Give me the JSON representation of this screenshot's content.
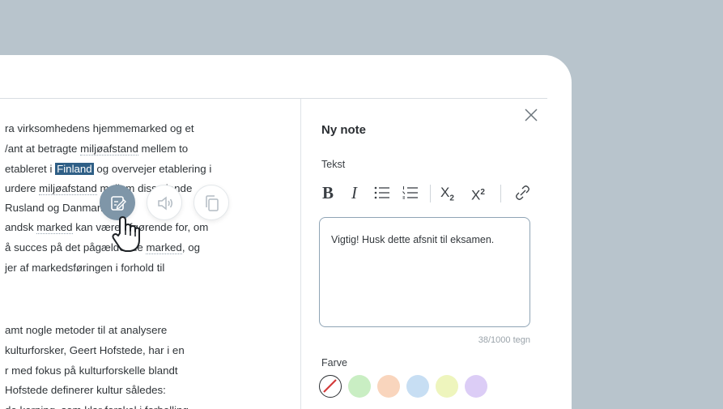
{
  "reader": {
    "lines": [
      [
        {
          "t": "ra virksomhedens hjemmemarked og et"
        }
      ],
      [
        {
          "t": "/ant at betragte "
        },
        {
          "t": "miljøafstand",
          "u": true
        },
        {
          "t": " mellem to"
        }
      ],
      [
        {
          "t": " etableret i "
        },
        {
          "t": "Finland",
          "h": true
        },
        {
          "t": " og overvejer etablering i"
        }
      ],
      [
        {
          "t": "urdere "
        },
        {
          "t": "miljøafstand",
          "u": true
        },
        {
          "t": " mellem disse lande"
        }
      ],
      [
        {
          "t": " Rusland og Danmark"
        }
      ],
      [
        {
          "t": "andsk "
        },
        {
          "t": "marked",
          "u": true
        },
        {
          "t": " kan være afgørende for, om"
        }
      ],
      [
        {
          "t": "å succes på det pågældende "
        },
        {
          "t": "marked",
          "u": true
        },
        {
          "t": ", og"
        }
      ],
      [
        {
          "t": "jer af markedsføringen i forhold til"
        }
      ],
      [
        {
          "t": "amt nogle metoder til at analysere"
        }
      ],
      [
        {
          "t": " kulturforsker, Geert Hofstede, har i en"
        }
      ],
      [
        {
          "t": "r med fokus på kulturforskelle blandt"
        }
      ],
      [
        {
          "t": "Hofstede definerer kultur således:"
        }
      ],
      [
        {
          "t": "de kerning, som klar forskel i forbelling"
        }
      ]
    ]
  },
  "floating_toolbar": {
    "buttons": [
      {
        "name": "note-button",
        "icon": "note-edit-icon",
        "active": true
      },
      {
        "name": "read-aloud-button",
        "icon": "speaker-icon",
        "active": false
      },
      {
        "name": "copy-button",
        "icon": "copy-icon",
        "active": false
      }
    ]
  },
  "note_panel": {
    "title": "Ny note",
    "text_label": "Tekst",
    "toolbar": {
      "bold": "B",
      "italic": "I",
      "subscript": "X",
      "subscript_mark": "2",
      "superscript": "X",
      "superscript_mark": "2"
    },
    "note_text": "Vigtig! Husk dette afsnit til eksamen.",
    "counter": "38/1000 tegn",
    "color_label": "Farve",
    "colors": [
      {
        "name": "none",
        "hex": "#ffffff"
      },
      {
        "name": "green",
        "hex": "#c9eec3"
      },
      {
        "name": "orange",
        "hex": "#f9d5bd"
      },
      {
        "name": "blue",
        "hex": "#c7def3"
      },
      {
        "name": "yellow",
        "hex": "#eef5bd"
      },
      {
        "name": "purple",
        "hex": "#dccdf6"
      }
    ]
  },
  "colors": {
    "highlight": "#2f5f86",
    "active_tool": "#7f96a8",
    "frame_bg": "#b8c4cc"
  }
}
